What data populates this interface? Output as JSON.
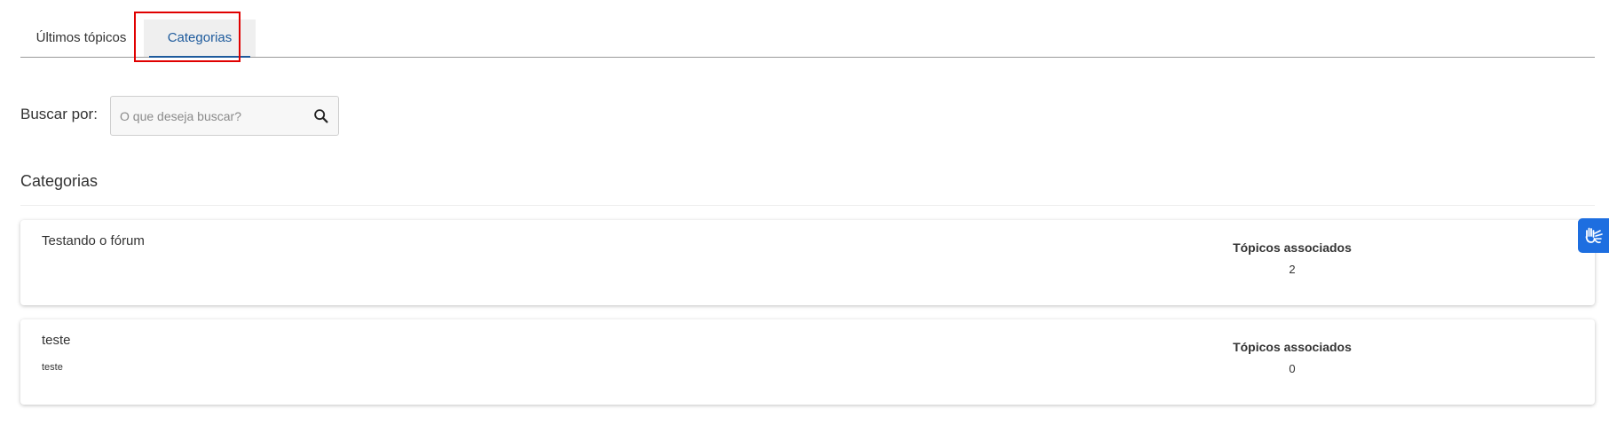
{
  "tabs": {
    "latest": "Últimos tópicos",
    "categories": "Categorias"
  },
  "search": {
    "label": "Buscar por:",
    "placeholder": "O que deseja buscar?"
  },
  "section": {
    "title": "Categorias"
  },
  "categories": [
    {
      "title": "Testando o fórum",
      "description": "",
      "stat_label": "Tópicos associados",
      "count": "2"
    },
    {
      "title": "teste",
      "description": "teste",
      "stat_label": "Tópicos associados",
      "count": "0"
    }
  ],
  "widgets": {
    "accessibility_icon": "sign-language-hands-icon",
    "accent_color": "#1d6ee0",
    "active_tab_color": "#1d5a9c"
  }
}
